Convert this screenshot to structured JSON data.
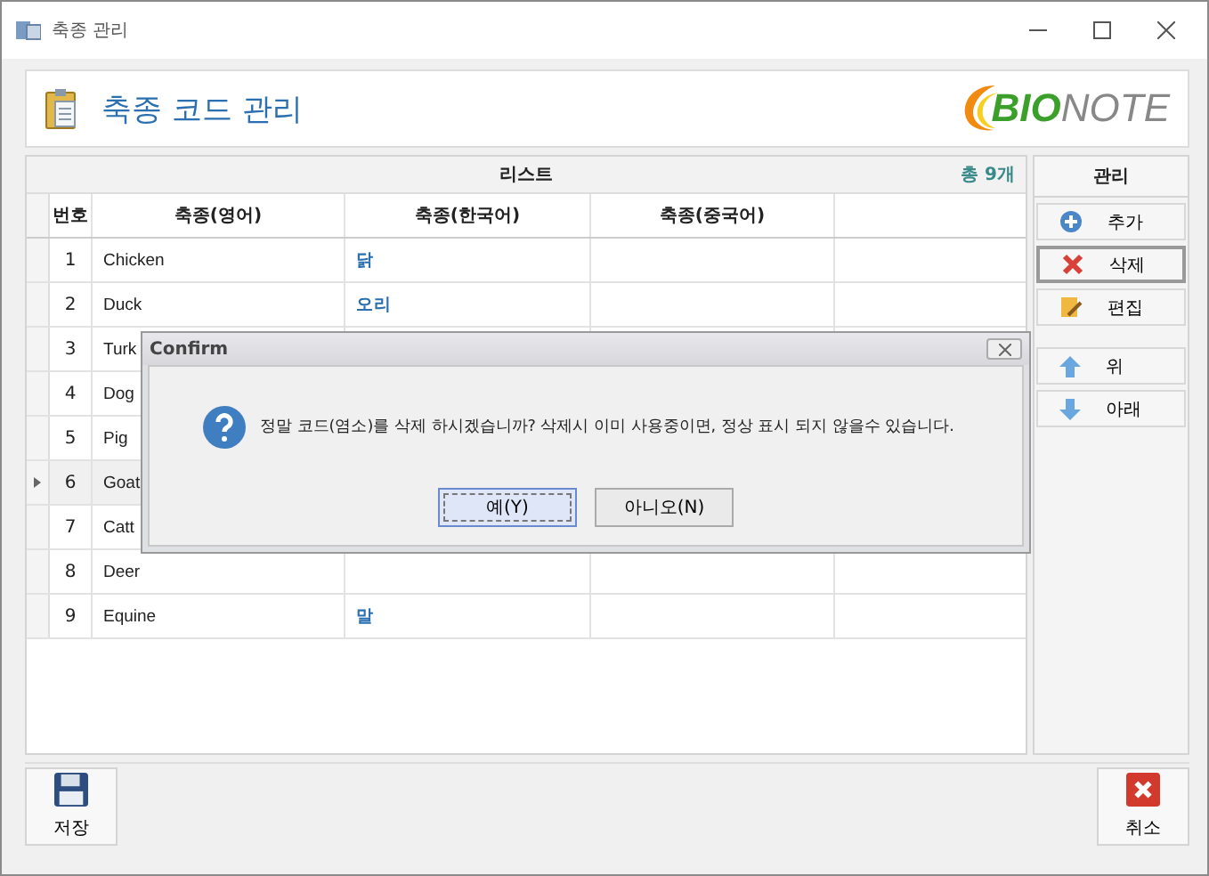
{
  "window": {
    "title": "축종 관리"
  },
  "header": {
    "title": "축종 코드 관리",
    "logo": {
      "part1": "BIO",
      "part2": "NOTE"
    }
  },
  "list": {
    "title": "리스트",
    "count": "총 9개",
    "columns": [
      "번호",
      "축종(영어)",
      "축종(한국어)",
      "축종(중국어)"
    ],
    "rows": [
      {
        "no": "1",
        "english": "Chicken",
        "korean": "닭",
        "selected": false
      },
      {
        "no": "2",
        "english": "Duck",
        "korean": "오리",
        "selected": false
      },
      {
        "no": "3",
        "english": "Turk",
        "selected": false
      },
      {
        "no": "4",
        "english": "Dog",
        "selected": false
      },
      {
        "no": "5",
        "english": "Pig",
        "selected": false
      },
      {
        "no": "6",
        "english": "Goat",
        "selected": true
      },
      {
        "no": "7",
        "english": "Catt",
        "selected": false
      },
      {
        "no": "8",
        "english": "Deer",
        "selected": false
      },
      {
        "no": "9",
        "english": "Equine",
        "korean": "말",
        "selected": false
      }
    ]
  },
  "side_panel": {
    "title": "관리",
    "buttons": [
      {
        "kind": "add",
        "label": "추가",
        "focused": false
      },
      {
        "kind": "delete",
        "label": "삭제",
        "focused": true
      },
      {
        "kind": "edit",
        "label": "편집",
        "focused": false
      },
      {
        "kind": "up",
        "label": "위",
        "focused": false
      },
      {
        "kind": "down",
        "label": "아래",
        "focused": false
      }
    ]
  },
  "bottom_buttons": [
    {
      "kind": "save",
      "label": "저장"
    },
    {
      "kind": "cancel",
      "label": "취소"
    }
  ],
  "dialog": {
    "title": "Confirm",
    "message": "정말 코드(염소)를 삭제 하시겠습니까? 삭제시 이미 사용중이면, 정상 표시 되지 않을수 있습니다.",
    "buttons": [
      {
        "label": "예(Y)",
        "default": true
      },
      {
        "label": "아니오(N)",
        "default": false
      }
    ]
  }
}
